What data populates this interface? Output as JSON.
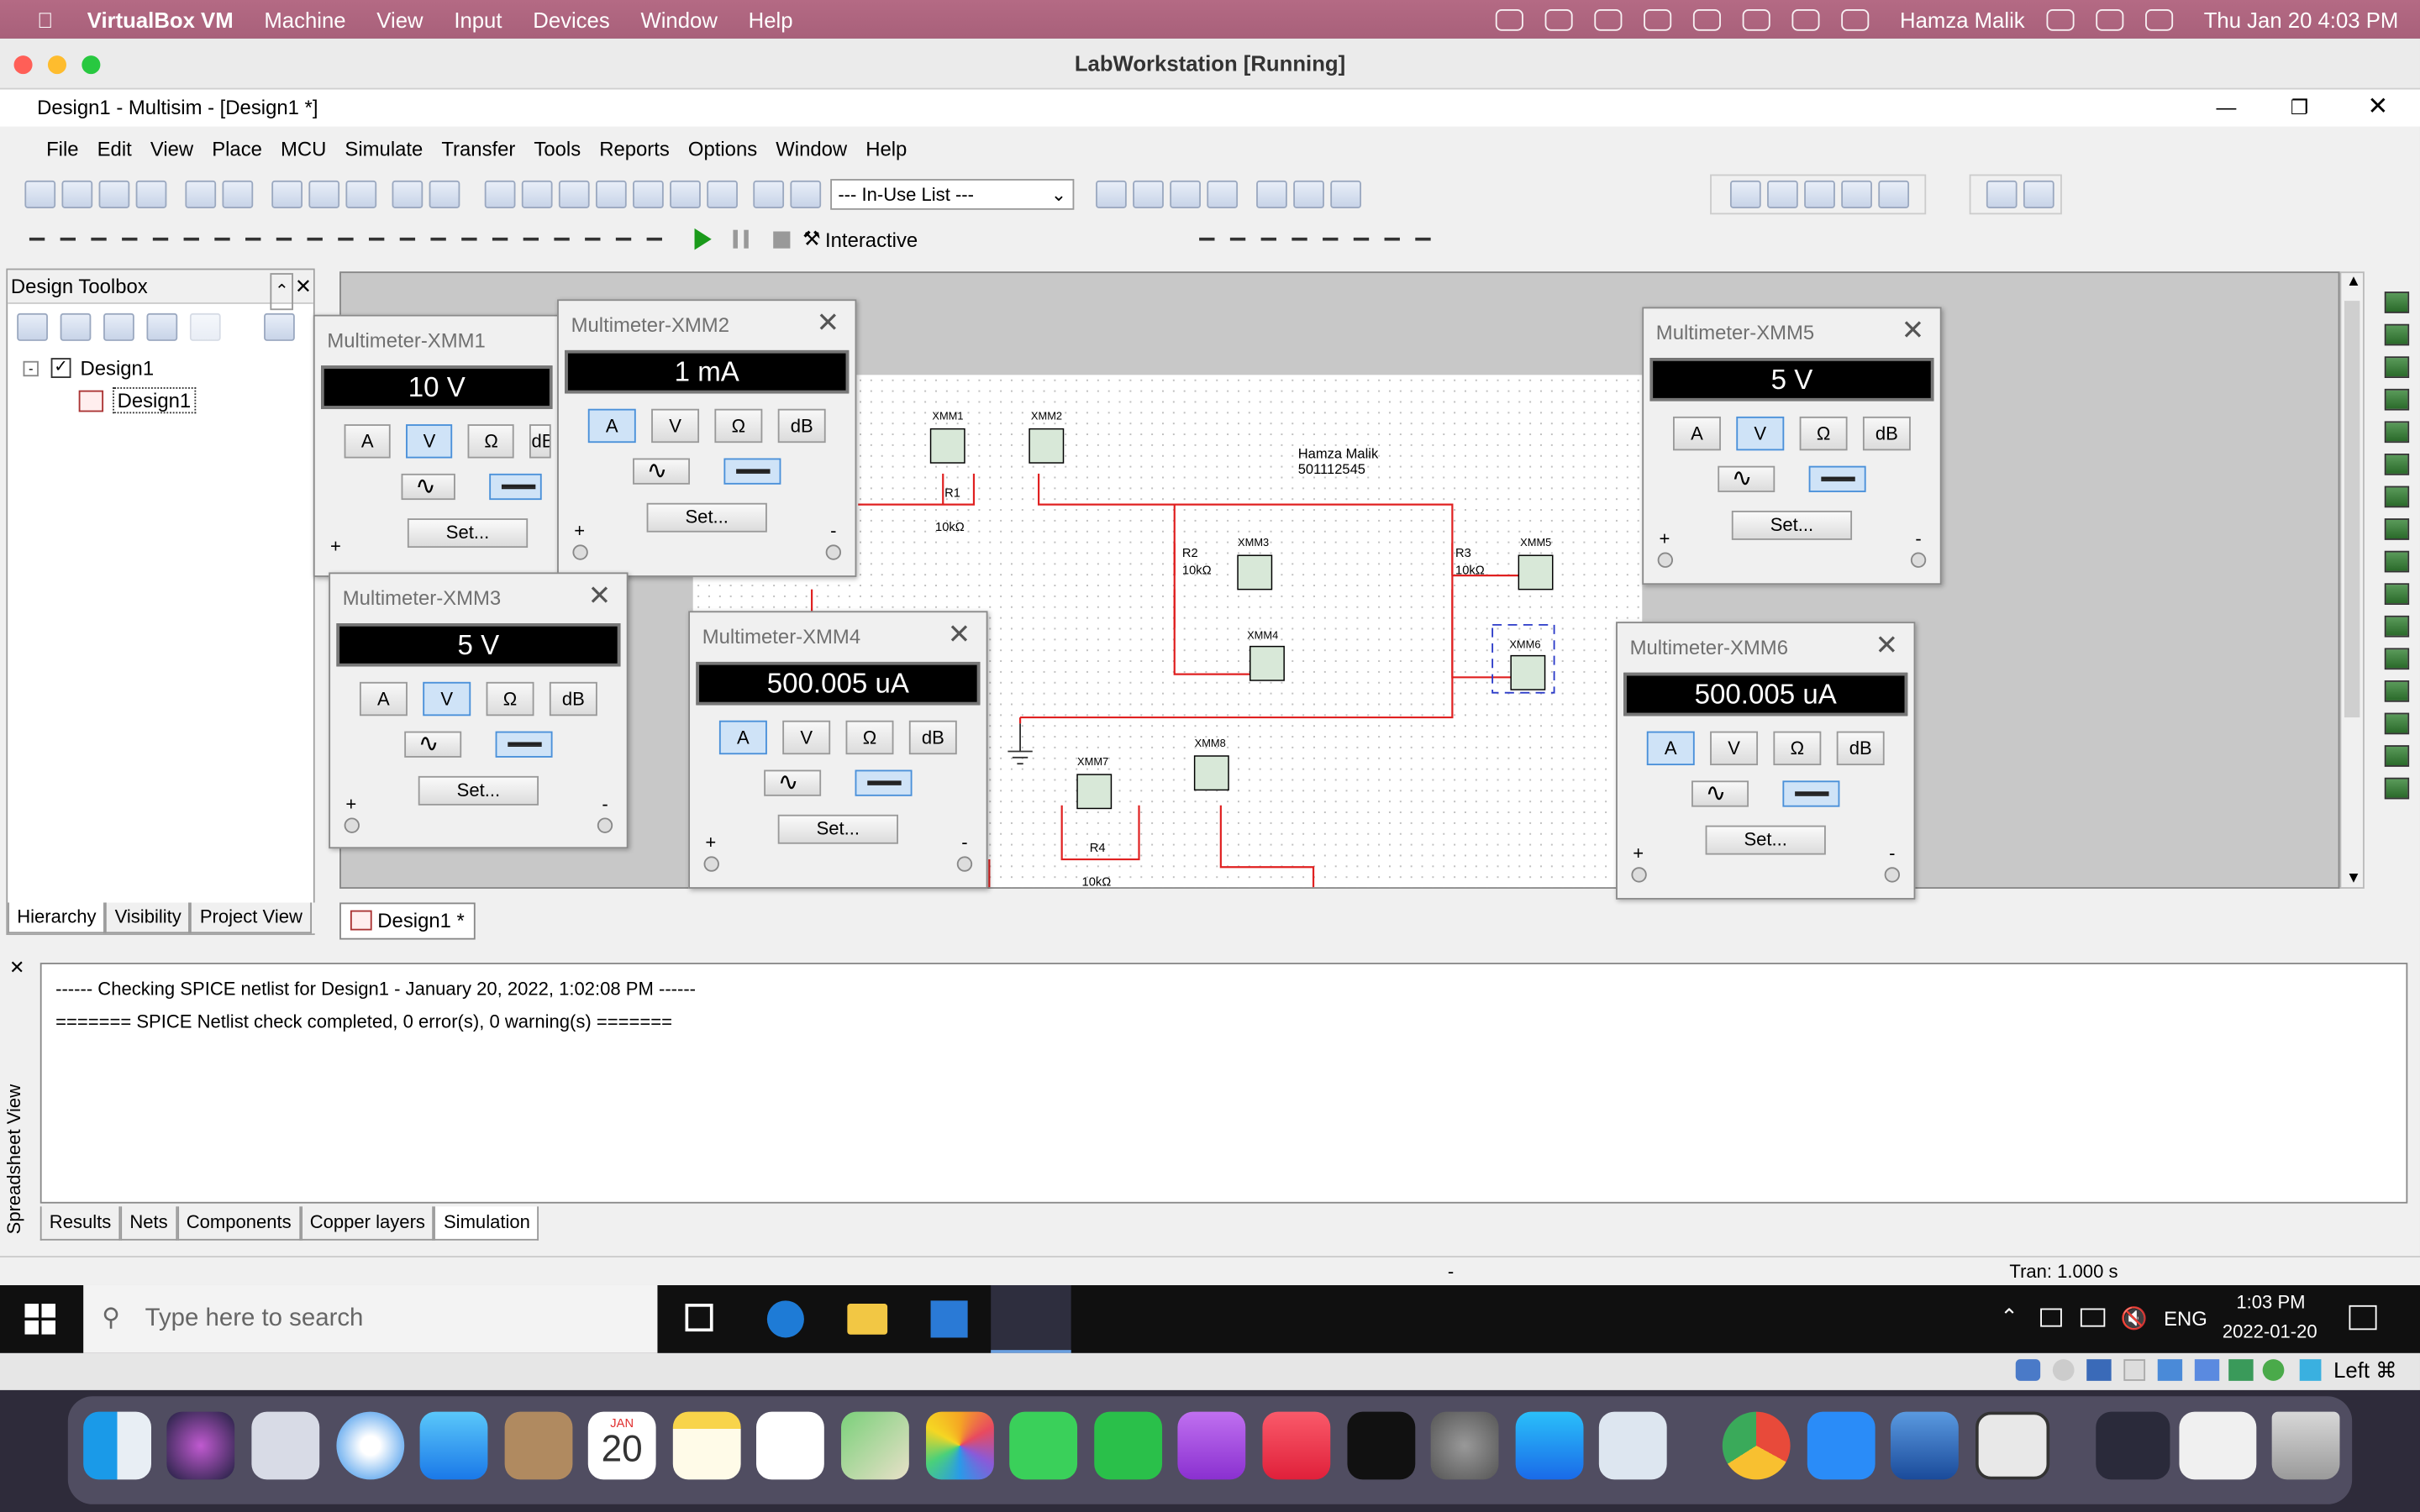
{
  "mac_menubar": {
    "app": "VirtualBox VM",
    "items": [
      "Machine",
      "View",
      "Input",
      "Devices",
      "Window",
      "Help"
    ],
    "user": "Hamza Malik",
    "datetime": "Thu Jan 20  4:03 PM"
  },
  "vbox": {
    "title": "LabWorkstation [Running]"
  },
  "multisim": {
    "window_title": "Design1 - Multisim - [Design1 *]",
    "menu": [
      "File",
      "Edit",
      "View",
      "Place",
      "MCU",
      "Simulate",
      "Transfer",
      "Tools",
      "Reports",
      "Options",
      "Window",
      "Help"
    ],
    "inuse_list": "--- In-Use List ---",
    "interactive": "Interactive",
    "toolbox": {
      "title": "Design Toolbox",
      "tree_root": "Design1",
      "tree_child": "Design1",
      "tabs": [
        "Hierarchy",
        "Visibility",
        "Project View"
      ]
    },
    "doc_tab": "Design1 *",
    "schematic": {
      "author": "Hamza Malik",
      "id": "501112545",
      "r1": "R1",
      "r1v": "10kΩ",
      "r2": "R2",
      "r2v": "10kΩ",
      "r3": "R3",
      "r3v": "10kΩ",
      "r4": "R4",
      "r4v": "10kΩ",
      "xmm1": "XMM1",
      "xmm2": "XMM2",
      "xmm3": "XMM3",
      "xmm4": "XMM4",
      "xmm5": "XMM5",
      "xmm6": "XMM6",
      "xmm7": "XMM7",
      "xmm8": "XMM8"
    },
    "meters": [
      {
        "title": "Multimeter-XMM1",
        "reading": "10 V",
        "mode": "V"
      },
      {
        "title": "Multimeter-XMM2",
        "reading": "1 mA",
        "mode": "A"
      },
      {
        "title": "Multimeter-XMM3",
        "reading": "5 V",
        "mode": "V"
      },
      {
        "title": "Multimeter-XMM4",
        "reading": "500.005 uA",
        "mode": "A"
      },
      {
        "title": "Multimeter-XMM5",
        "reading": "5 V",
        "mode": "V"
      },
      {
        "title": "Multimeter-XMM6",
        "reading": "500.005 uA",
        "mode": "A"
      }
    ],
    "meter_buttons": {
      "a": "A",
      "v": "V",
      "ohm": "Ω",
      "db": "dB",
      "set": "Set...",
      "plus": "+",
      "minus": "-"
    },
    "output": {
      "line1": "------ Checking SPICE netlist for Design1 - January 20, 2022, 1:02:08 PM ------",
      "line2": "======= SPICE Netlist check completed, 0 error(s), 0 warning(s) ======="
    },
    "output_tabs": [
      "Results",
      "Nets",
      "Components",
      "Copper layers",
      "Simulation"
    ],
    "side_label": "Spreadsheet View",
    "status": {
      "mid": "-",
      "tran": "Tran: 1.000 s"
    }
  },
  "taskbar": {
    "search": "Type here to search",
    "lang": "ENG",
    "time": "1:03 PM",
    "date": "2022-01-20"
  },
  "vbox_status": {
    "host_key": "Left ⌘"
  },
  "dock": {
    "calendar_month": "JAN",
    "calendar_day": "20"
  }
}
